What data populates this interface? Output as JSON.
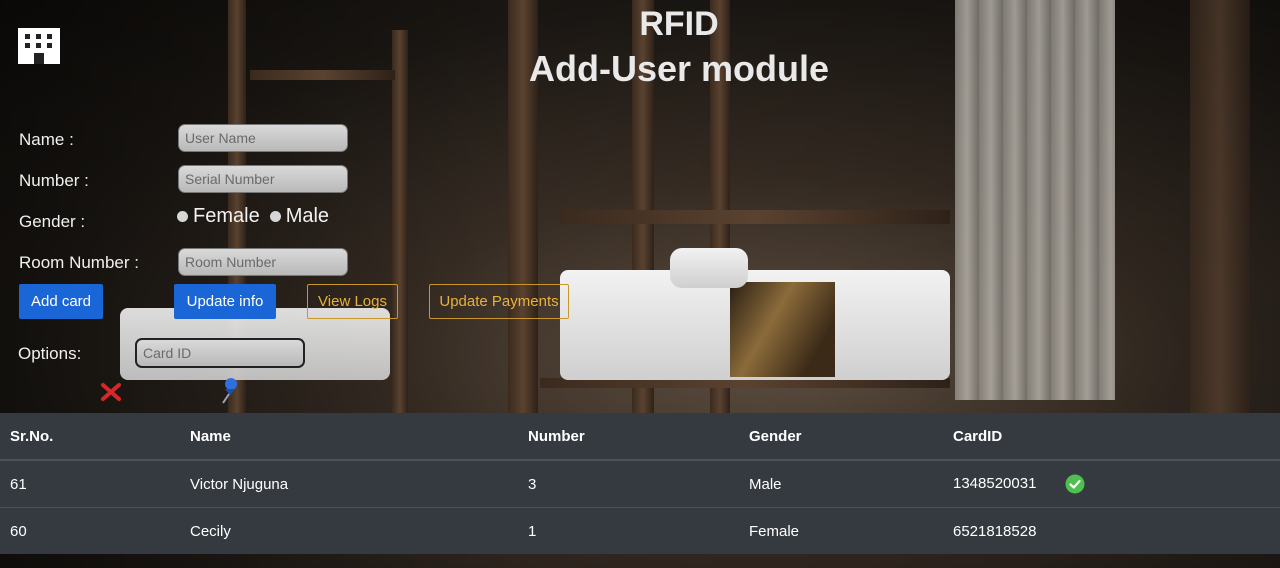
{
  "header": {
    "title_line1": "RFID",
    "title_line2": "Add-User module",
    "logo_icon": "building-icon"
  },
  "form": {
    "name_label": "Name :",
    "name_placeholder": "User Name",
    "number_label": "Number :",
    "number_placeholder": "Serial Number",
    "gender_label": "Gender :",
    "gender_options": [
      "Female",
      "Male"
    ],
    "room_label": "Room Number :",
    "room_placeholder": "Room Number",
    "options_label": "Options:",
    "card_placeholder": "Card ID"
  },
  "buttons": {
    "add_card": "Add card",
    "update_info": "Update info",
    "view_logs": "View Logs",
    "update_payments": "Update Payments"
  },
  "icons": {
    "delete": "red-x-icon",
    "pin": "push-pin-icon",
    "verified": "check-circle-icon"
  },
  "colors": {
    "primary": "#1a66d6",
    "outline": "#e8b23a",
    "table_bg": "#343a40",
    "check": "#4fbf4f",
    "delete": "#d62828"
  },
  "table": {
    "headers": [
      "Sr.No.",
      "Name",
      "Number",
      "Gender",
      "CardID"
    ],
    "rows": [
      {
        "sr": "61",
        "name": "Victor Njuguna",
        "number": "3",
        "gender": "Male",
        "card": "1348520031",
        "verified": true
      },
      {
        "sr": "60",
        "name": "Cecily",
        "number": "1",
        "gender": "Female",
        "card": "6521818528",
        "verified": false
      }
    ]
  }
}
